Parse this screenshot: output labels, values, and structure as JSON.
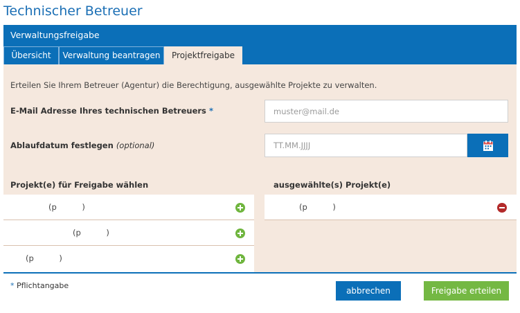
{
  "page": {
    "title": "Technischer Betreuer"
  },
  "section": {
    "title": "Verwaltungsfreigabe"
  },
  "tabs": [
    {
      "label": "Übersicht"
    },
    {
      "label": "Verwaltung beantragen"
    },
    {
      "label": "Projektfreigabe",
      "active": true
    }
  ],
  "form": {
    "intro": "Erteilen Sie Ihrem Betreuer (Agentur) die Berechtigung, ausgewählte Projekte zu verwalten.",
    "email_label": "E-Mail Adresse Ihres technischen Betreuers",
    "email_required_mark": "*",
    "email_placeholder": "muster@mail.de",
    "email_value": "",
    "date_label": "Ablaufdatum festlegen",
    "date_optional": "(optional)",
    "date_placeholder": "TT.MM.JJJJ",
    "date_value": ""
  },
  "projects": {
    "available_header": "Projekt(e) für Freigabe wählen",
    "selected_header": "ausgewählte(s) Projekt(e)",
    "available": [
      {
        "text": "(p          )"
      },
      {
        "text": "(p          )"
      },
      {
        "text": "(p          )"
      }
    ],
    "selected": [
      {
        "text": "(p          )"
      }
    ]
  },
  "footer": {
    "required_mark": "*",
    "required_note": "Pflichtangabe",
    "cancel_label": "abbrechen",
    "submit_label": "Freigabe erteilen"
  },
  "icons": {
    "add": "plus-circle-icon",
    "remove": "minus-circle-icon",
    "calendar": "calendar-icon"
  },
  "colors": {
    "brand_blue": "#0b6fb8",
    "panel_bg": "#f5e8de",
    "submit_green": "#74b843",
    "add_green": "#6fb53e",
    "remove_red": "#b32a2a"
  }
}
